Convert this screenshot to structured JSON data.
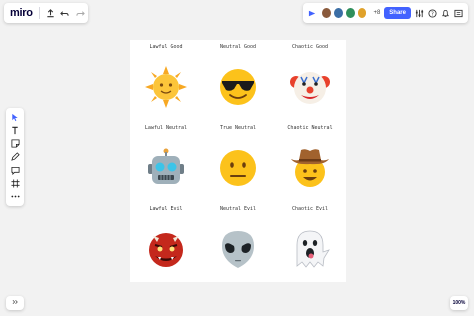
{
  "app": {
    "logo": "miro"
  },
  "header": {
    "share_label": "Share",
    "collaborators_more": "+8"
  },
  "toolbar": {
    "tools": [
      "select",
      "text",
      "sticky-note",
      "pen",
      "comment",
      "frame",
      "more"
    ]
  },
  "board": {
    "cells": [
      {
        "label": "Lawful Good",
        "emoji": "sun-with-face"
      },
      {
        "label": "Neutral Good",
        "emoji": "smiling-face-with-sunglasses"
      },
      {
        "label": "Chaotic Good",
        "emoji": "clown-face"
      },
      {
        "label": "Lawful Neutral",
        "emoji": "robot"
      },
      {
        "label": "True Neutral",
        "emoji": "neutral-face"
      },
      {
        "label": "Chaotic Neutral",
        "emoji": "cowboy-hat-face"
      },
      {
        "label": "Lawful Evil",
        "emoji": "ogre"
      },
      {
        "label": "Neutral Evil",
        "emoji": "alien"
      },
      {
        "label": "Chaotic Evil",
        "emoji": "ghost"
      }
    ]
  },
  "footer": {
    "zoom": "100%"
  },
  "colors": {
    "accent": "#4262ff",
    "canvas": "#f2f2f2"
  }
}
